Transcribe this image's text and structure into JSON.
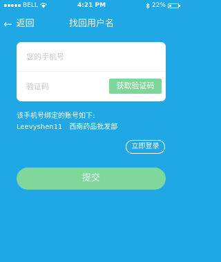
{
  "status_bar": {
    "carrier": "BELL",
    "time": "4:21 PM",
    "battery": "22%",
    "icons": [
      "signal-icon",
      "wifi-icon",
      "bluetooth-icon",
      "battery-icon"
    ]
  },
  "nav": {
    "back_label": "返回",
    "title": "找回用户名"
  },
  "form": {
    "phone_placeholder": "您的手机号",
    "code_placeholder": "验证码",
    "get_code_label": "获取验证码"
  },
  "info": {
    "bound_accounts_text": "该手机号绑定的账号如下:",
    "account_username": "Leevyshen11",
    "account_company": "西南药品批发部"
  },
  "actions": {
    "login_label": "立即登录",
    "submit_label": "提交"
  },
  "colors": {
    "background": "#1fa8e5",
    "accent_green": "#7fd79b",
    "card": "#ffffff"
  }
}
